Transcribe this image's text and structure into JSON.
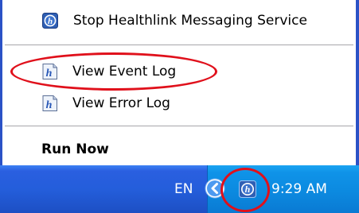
{
  "menu": {
    "items": [
      {
        "label": "Stop Healthlink Messaging Service",
        "icon": "healthlink-icon"
      },
      {
        "label": "View Event Log",
        "icon": "log-document-icon"
      },
      {
        "label": "View Error Log",
        "icon": "log-document-icon"
      },
      {
        "label": "Run Now",
        "icon": ""
      }
    ]
  },
  "taskbar": {
    "language": "EN",
    "tray_icon": "healthlink-icon",
    "expand_icon": "chevron-left-icon",
    "clock": "9:29 AM"
  },
  "colors": {
    "annotation": "#e0101b",
    "menu_border": "#2b52c6",
    "taskbar": "#245edb",
    "tray": "#0c8ae0"
  }
}
